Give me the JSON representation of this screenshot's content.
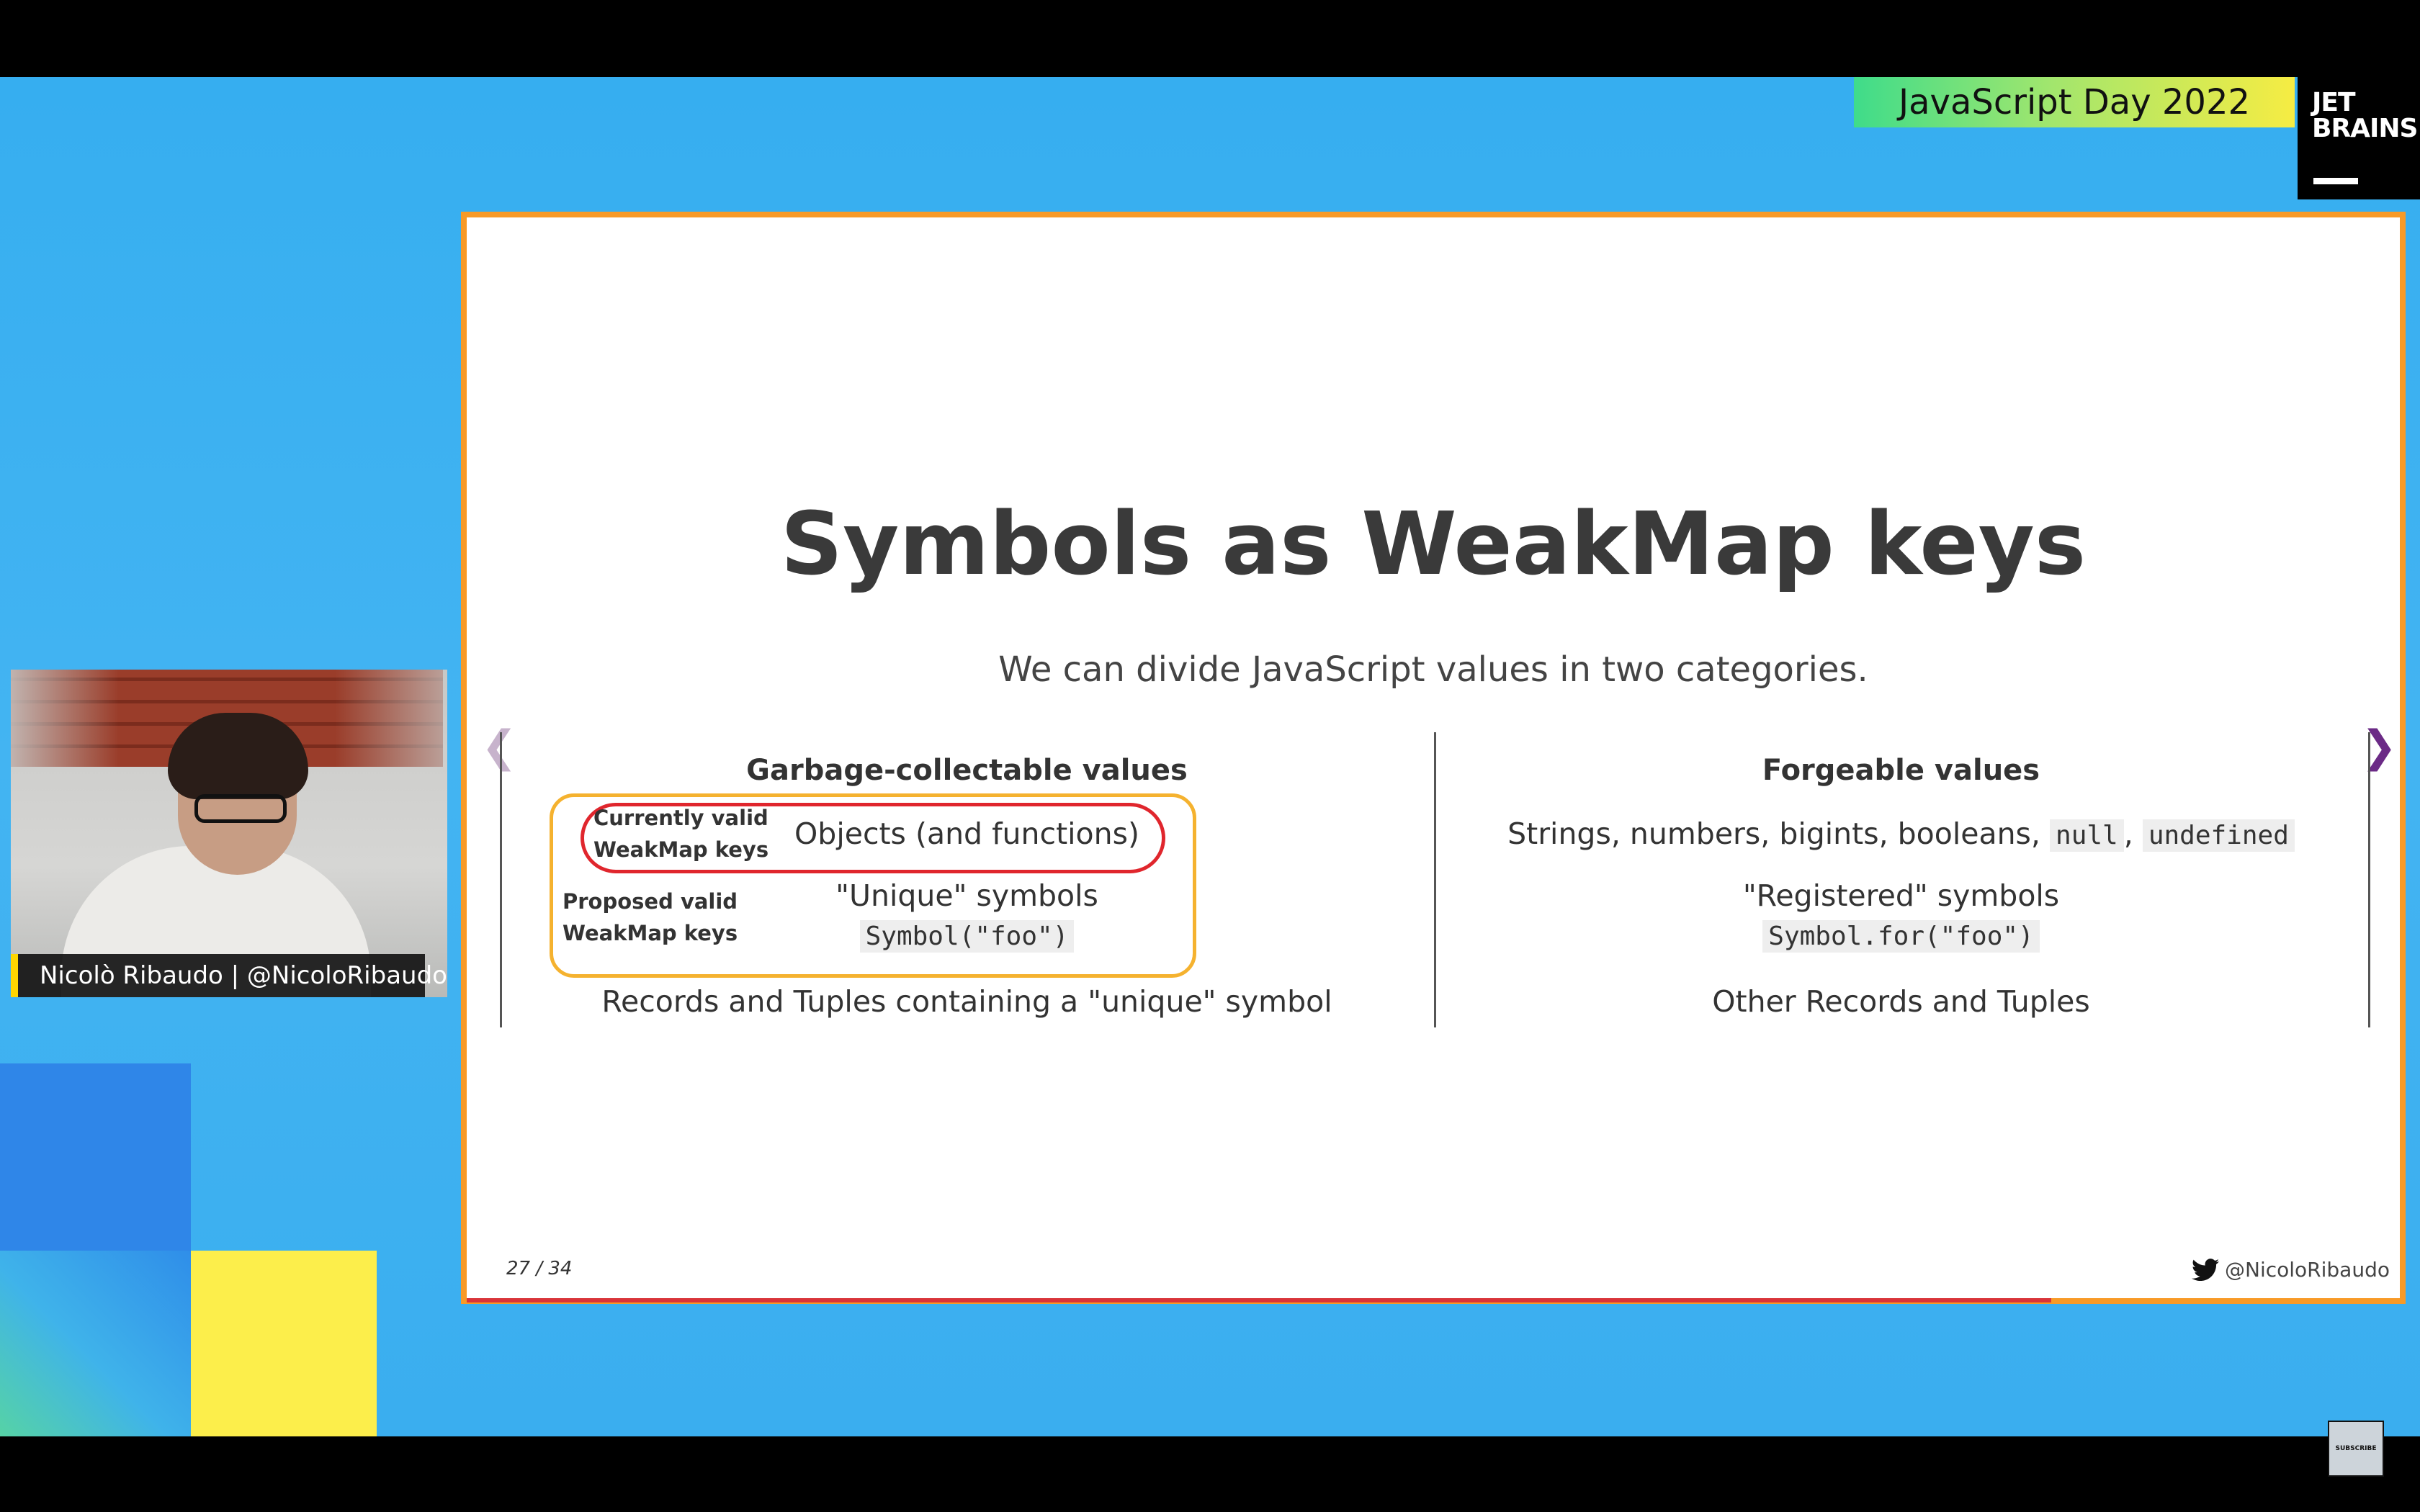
{
  "event": {
    "name": "JavaScript Day 2022",
    "logo_text": "JET\nBRAINS"
  },
  "slide": {
    "title": "Symbols as WeakMap keys",
    "subtitle": "We can divide JavaScript values in two categories.",
    "left_column": {
      "heading": "Garbage-collectable values",
      "currently_valid_label": "Currently valid\nWeakMap keys",
      "objects": "Objects (and functions)",
      "proposed_valid_label": "Proposed valid\nWeakMap keys",
      "unique_symbols": "\"Unique\" symbols",
      "unique_code": "Symbol(\"foo\")",
      "records": "Records and Tuples containing a \"unique\" symbol"
    },
    "right_column": {
      "heading": "Forgeable values",
      "primitives": "Strings, numbers, bigints, booleans,",
      "null_code": "null",
      "comma": ",",
      "undefined_code": "undefined",
      "registered_symbols": "\"Registered\" symbols",
      "registered_code": "Symbol.for(\"foo\")",
      "other_records": "Other Records and Tuples"
    },
    "page_counter": "27 / 34",
    "twitter_handle": "@NicoloRibaudo"
  },
  "speaker": {
    "name_tag": "Nicolò Ribaudo | @NicoloRibaudo"
  },
  "overlay": {
    "subscribe_label": "SUBSCRIBE"
  },
  "colors": {
    "slide_border": "#f89a27",
    "highlight_red": "#e0262d",
    "highlight_yellow": "#f5b22f",
    "background_blue": "#3aaeef"
  }
}
